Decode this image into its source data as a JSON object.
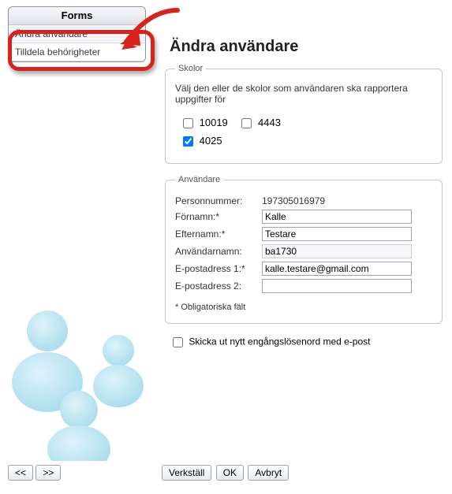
{
  "sidebar": {
    "title": "Forms",
    "items": [
      {
        "label": "Ändra användare"
      },
      {
        "label": "Tilldela behörigheter"
      }
    ]
  },
  "nav": {
    "prev": "<<",
    "next": ">>"
  },
  "main": {
    "title": "Ändra användare"
  },
  "skolor": {
    "legend": "Skolor",
    "help": "Välj den eller de skolor som användaren ska rapportera uppgifter för",
    "options": [
      {
        "label": "10019",
        "checked": false
      },
      {
        "label": "4443",
        "checked": false
      },
      {
        "label": "4025",
        "checked": true
      }
    ]
  },
  "anvandare": {
    "legend": "Användare",
    "fields": {
      "personnummer_label": "Personnummer:",
      "personnummer_value": "197305016979",
      "fornamn_label": "Förnamn:*",
      "fornamn_value": "Kalle",
      "efternamn_label": "Efternamn:*",
      "efternamn_value": "Testare",
      "anvandarnamn_label": "Användarnamn:",
      "anvandarnamn_value": "ba1730",
      "epost1_label": "E-postadress 1:*",
      "epost1_value": "kalle.testare@gmail.com",
      "epost2_label": "E-postadress 2:",
      "epost2_value": ""
    },
    "note": "* Obligatoriska fält",
    "send_pw_label": "Skicka ut nytt engångslösenord med e-post",
    "send_pw_checked": false
  },
  "buttons": {
    "verkstall": "Verkställ",
    "ok": "OK",
    "avbryt": "Avbryt"
  },
  "annotation": {
    "highlight_color": "#d8231c"
  }
}
